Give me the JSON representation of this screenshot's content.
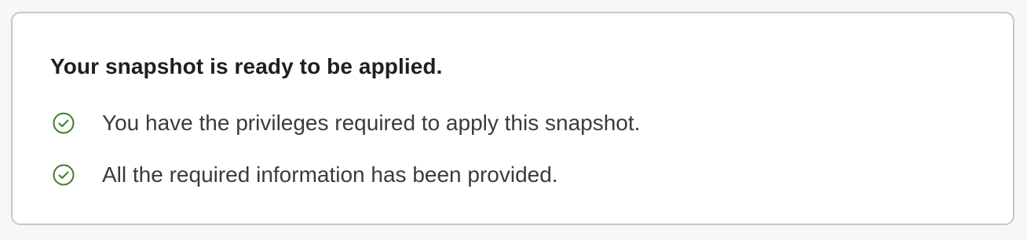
{
  "card": {
    "title": "Your snapshot is ready to be applied.",
    "checks": [
      {
        "icon": "check-circle-icon",
        "status": "passed",
        "text": "You have the privileges required to apply this snapshot."
      },
      {
        "icon": "check-circle-icon",
        "status": "passed",
        "text": "All the required information has been provided."
      }
    ]
  },
  "colors": {
    "success": "#3e7d28",
    "border": "#c6c6cc",
    "title_text": "#1f1f1f",
    "body_text": "#3b3b3f"
  }
}
